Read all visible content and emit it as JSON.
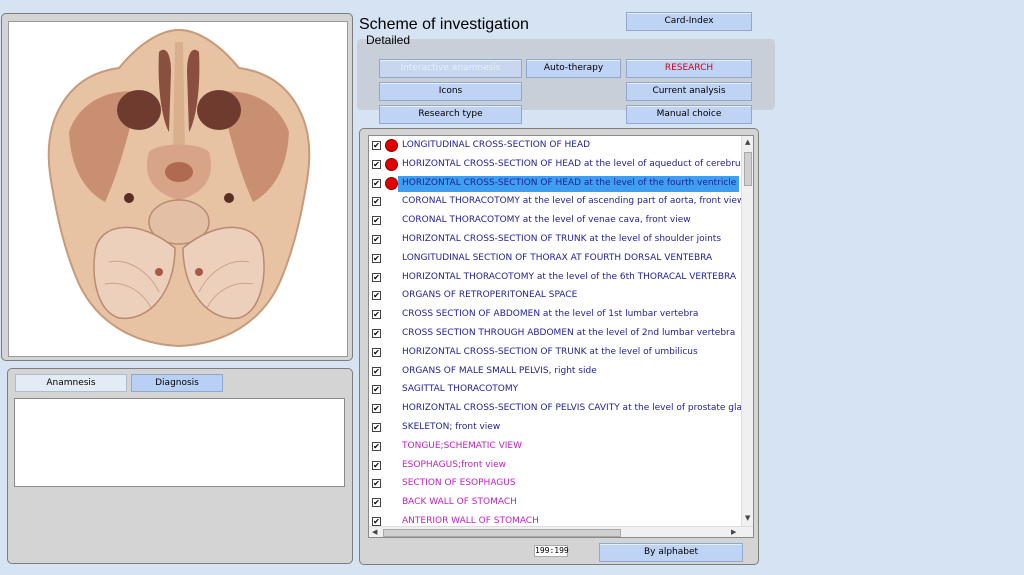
{
  "header": {
    "title": "Scheme of investigation",
    "mode_label": "Detailed"
  },
  "buttons": {
    "card_index": "Card-Index",
    "interactive_anamnesis": "Interactive anamnesis",
    "auto_therapy": "Auto-therapy",
    "research": "RESEARCH",
    "icons": "Icons",
    "current_analysis": "Current analysis",
    "research_type": "Research type",
    "manual_choice": "Manual choice",
    "by_alphabet": "By alphabet"
  },
  "notes_tabs": {
    "anamnesis": "Anamnesis",
    "diagnosis": "Diagnosis"
  },
  "colors": {
    "accent_red": "#d2001a",
    "item_blue": "#1f1f9a",
    "item_magenta": "#c41ec4",
    "selection": "#3f9ef0"
  },
  "image": {
    "icon": "cross-section-head-image"
  },
  "list": {
    "items": [
      {
        "label": "LONGITUDINAL CROSS-SECTION OF HEAD",
        "checked": true,
        "dot": true,
        "color": "blue",
        "selected": false
      },
      {
        "label": "HORIZONTAL CROSS-SECTION OF HEAD at the level of aqueduct of cerebrum",
        "checked": true,
        "dot": true,
        "color": "blue",
        "selected": false
      },
      {
        "label": "HORIZONTAL CROSS-SECTION OF HEAD at the level of the fourth ventricle",
        "checked": true,
        "dot": true,
        "color": "blue",
        "selected": true
      },
      {
        "label": "CORONAL THORACOTOMY at the level of ascending part of aorta, front view",
        "checked": true,
        "dot": false,
        "color": "blue",
        "selected": false
      },
      {
        "label": "CORONAL THORACOTOMY at the level of venae cava, front view",
        "checked": true,
        "dot": false,
        "color": "blue",
        "selected": false
      },
      {
        "label": "HORIZONTAL CROSS-SECTION OF TRUNK at the level of shoulder joints",
        "checked": true,
        "dot": false,
        "color": "blue",
        "selected": false
      },
      {
        "label": "LONGITUDINAL  SECTION  OF  THORAX  AT  FOURTH  DORSAL  VENTEBRA",
        "checked": true,
        "dot": false,
        "color": "blue",
        "selected": false
      },
      {
        "label": "HORIZONTAL THORACOTOMY at the level of the 6th THORACAL VERTEBRA",
        "checked": true,
        "dot": false,
        "color": "blue",
        "selected": false
      },
      {
        "label": "ORGANS OF RETROPERITONEAL SPACE",
        "checked": true,
        "dot": false,
        "color": "blue",
        "selected": false
      },
      {
        "label": "CROSS SECTION OF ABDOMEN at the level of 1st lumbar vertebra",
        "checked": true,
        "dot": false,
        "color": "blue",
        "selected": false
      },
      {
        "label": "CROSS SECTION THROUGH ABDOMEN at the level of 2nd lumbar vertebra",
        "checked": true,
        "dot": false,
        "color": "blue",
        "selected": false
      },
      {
        "label": "HORIZONTAL CROSS-SECTION OF TRUNK at the level of umbilicus",
        "checked": true,
        "dot": false,
        "color": "blue",
        "selected": false
      },
      {
        "label": "ORGANS OF MALE SMALL PELVIS, right side",
        "checked": true,
        "dot": false,
        "color": "blue",
        "selected": false
      },
      {
        "label": "SAGITTAL THORACOTOMY",
        "checked": true,
        "dot": false,
        "color": "blue",
        "selected": false
      },
      {
        "label": "HORIZONTAL CROSS-SECTION OF PELVIS CAVITY at the level of prostate glan",
        "checked": true,
        "dot": false,
        "color": "blue",
        "selected": false
      },
      {
        "label": "SKELETON;  front  view",
        "checked": true,
        "dot": false,
        "color": "blue",
        "selected": false
      },
      {
        "label": "TONGUE;SCHEMATIC VIEW",
        "checked": true,
        "dot": false,
        "color": "magenta",
        "selected": false
      },
      {
        "label": "ESOPHAGUS;front view",
        "checked": true,
        "dot": false,
        "color": "magenta",
        "selected": false
      },
      {
        "label": "SECTION OF ESOPHAGUS",
        "checked": true,
        "dot": false,
        "color": "magenta",
        "selected": false
      },
      {
        "label": "BACK WALL OF STOMACH",
        "checked": true,
        "dot": false,
        "color": "magenta",
        "selected": false
      },
      {
        "label": "ANTERIOR  WALL  OF  STOMACH",
        "checked": true,
        "dot": false,
        "color": "magenta",
        "selected": false
      }
    ]
  },
  "counter": "199:199"
}
